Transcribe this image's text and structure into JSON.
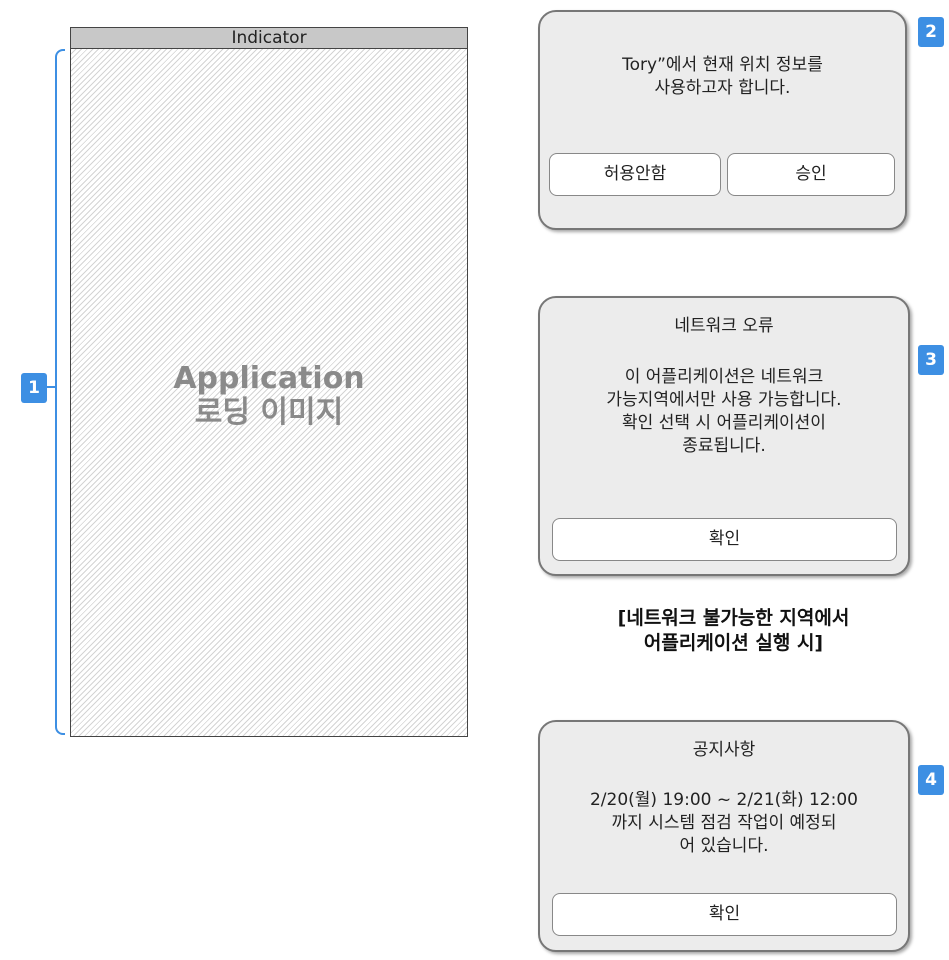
{
  "phone": {
    "indicator": "Indicator",
    "loading_line1": "Application",
    "loading_line2": "로딩 이미지"
  },
  "badges": {
    "b1": "1",
    "b2": "2",
    "b3": "3",
    "b4": "4"
  },
  "dialog_location": {
    "message_line1": "Tory”에서 현재 위치 정보를",
    "message_line2": "사용하고자 합니다.",
    "deny_label": "허용안함",
    "allow_label": "승인"
  },
  "dialog_network": {
    "title": "네트워크 오류",
    "message_line1": "이 어플리케이션은 네트워크",
    "message_line2": "가능지역에서만 사용 가능합니다.",
    "message_line3": "확인 선택 시 어플리케이션이",
    "message_line4": "종료됩니다.",
    "confirm_label": "확인"
  },
  "caption": {
    "line1": "[네트워크 불가능한 지역에서",
    "line2": "어플리케이션 실행 시]"
  },
  "dialog_notice": {
    "title": "공지사항",
    "message_line1": "2/20(월) 19:00 ~ 2/21(화) 12:00",
    "message_line2": "까지 시스템 점검 작업이 예정되",
    "message_line3": "어 있습니다.",
    "confirm_label": "확인"
  },
  "colors": {
    "accent": "#3d8fe3",
    "dialog_bg": "#ececec",
    "indicator_bg": "#c8c8c8"
  }
}
